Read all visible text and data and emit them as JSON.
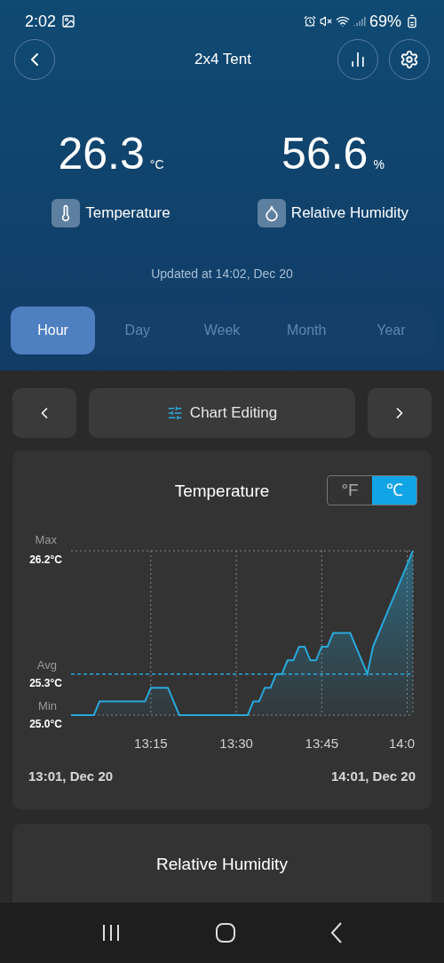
{
  "status_bar": {
    "time": "2:02",
    "battery": "69%"
  },
  "header": {
    "title": "2x4 Tent"
  },
  "readings": [
    {
      "kind": "temperature",
      "value": "26.3",
      "unit": "°C",
      "label": "Temperature"
    },
    {
      "kind": "humidity",
      "value": "56.6",
      "unit": "%",
      "label": "Relative Humidity"
    }
  ],
  "updated": "Updated at 14:02, Dec 20",
  "tabs": [
    {
      "label": "Hour",
      "selected": true
    },
    {
      "label": "Day",
      "selected": false
    },
    {
      "label": "Week",
      "selected": false
    },
    {
      "label": "Month",
      "selected": false
    },
    {
      "label": "Year",
      "selected": false
    }
  ],
  "chart_nav": {
    "label": "Chart Editing"
  },
  "temperature_card": {
    "title": "Temperature",
    "units": [
      {
        "label": "°F",
        "selected": false
      },
      {
        "label": "℃",
        "selected": true
      }
    ],
    "stat_names": [
      "Max",
      "Avg",
      "Min"
    ],
    "chart_data": {
      "type": "area",
      "categories": [
        null,
        null,
        null,
        null,
        null,
        null,
        null,
        null,
        null,
        null,
        null,
        null,
        null,
        null,
        "13:15",
        null,
        null,
        null,
        null,
        null,
        null,
        null,
        null,
        null,
        null,
        null,
        null,
        null,
        null,
        "13:30",
        null,
        null,
        null,
        null,
        null,
        null,
        null,
        null,
        null,
        null,
        null,
        null,
        null,
        null,
        "13:45",
        null,
        null,
        null,
        null,
        null,
        null,
        null,
        null,
        null,
        null,
        null,
        null,
        null,
        null,
        "14:0",
        null
      ],
      "series": [
        {
          "color": "#29a9dc",
          "values": [
            25.0,
            25.0,
            25.0,
            25.0,
            25.0,
            25.1,
            25.1,
            25.1,
            25.1,
            25.1,
            25.1,
            25.1,
            25.1,
            25.1,
            25.2,
            25.2,
            25.2,
            25.2,
            25.1,
            25.0,
            25.0,
            25.0,
            25.0,
            25.0,
            25.0,
            25.0,
            25.0,
            25.0,
            25.0,
            25.0,
            25.0,
            25.0,
            25.1,
            25.1,
            25.2,
            25.2,
            25.3,
            25.3,
            25.4,
            25.4,
            25.5,
            25.5,
            25.4,
            25.4,
            25.5,
            25.5,
            25.6,
            25.6,
            25.6,
            25.6,
            25.5,
            25.4,
            25.3,
            25.5,
            25.6,
            25.7,
            25.8,
            25.9,
            26.0,
            26.1,
            26.2
          ]
        }
      ],
      "ylim": [
        25.0,
        26.2
      ],
      "grid": true,
      "ref_lines": [
        {
          "axis": "y",
          "value": 25.3,
          "color": "#29a9dc"
        }
      ],
      "yticks": [
        {
          "value": 26.2,
          "label": "26.2°C"
        },
        {
          "value": 25.3,
          "label": "25.3°C"
        },
        {
          "value": 25.0,
          "label": "25.0°C"
        }
      ]
    },
    "start": "13:01, Dec 20",
    "end": "14:01, Dec 20"
  },
  "humidity_card": {
    "title": "Relative Humidity"
  }
}
